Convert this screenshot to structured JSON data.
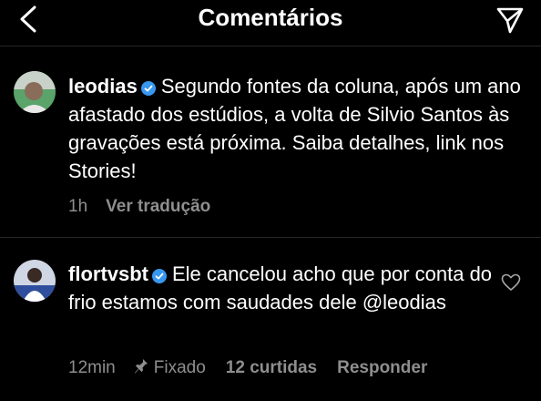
{
  "header": {
    "title": "Comentários"
  },
  "caption": {
    "username": "leodias",
    "text": "Segundo fontes da coluna, após um ano afastado dos estúdios, a volta de Silvio Santos às gravações está próxima. Saiba detalhes, link nos Stories!",
    "time": "1h",
    "translate_label": "Ver tradução"
  },
  "comment": {
    "username": "flortvsbt",
    "text": "Ele cancelou acho que por conta do frio estamos com saudades dele @leodias",
    "time": "12min",
    "pinned_label": "Fixado",
    "likes_label": "12 curtidas",
    "reply_label": "Responder"
  },
  "colors": {
    "background": "#000000",
    "text": "#ffffff",
    "secondary": "#8e8e8e",
    "verified": "#3897f0"
  },
  "icons": [
    "chevron-left-icon",
    "send-icon",
    "verified-badge-icon",
    "pin-icon",
    "heart-icon"
  ]
}
